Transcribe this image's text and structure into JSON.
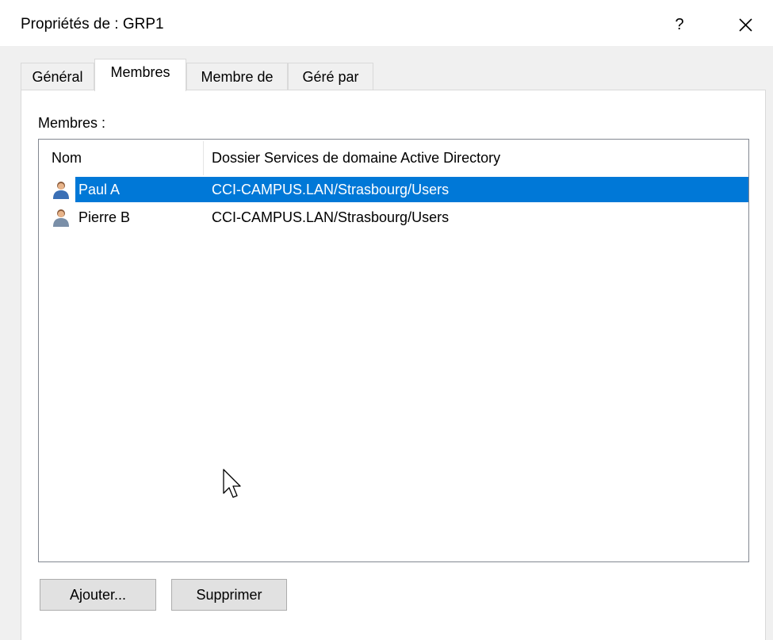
{
  "window": {
    "title": "Propriétés de : GRP1",
    "help_label": "?"
  },
  "tabs": [
    {
      "label": "Général",
      "active": false
    },
    {
      "label": "Membres",
      "active": true
    },
    {
      "label": "Membre de",
      "active": false
    },
    {
      "label": "Géré par",
      "active": false
    }
  ],
  "members": {
    "label": "Membres :",
    "columns": [
      "Nom",
      "Dossier Services de domaine Active Directory"
    ],
    "rows": [
      {
        "name": "Paul A",
        "folder": "CCI-CAMPUS.LAN/Strasbourg/Users",
        "selected": true
      },
      {
        "name": "Pierre B",
        "folder": "CCI-CAMPUS.LAN/Strasbourg/Users",
        "selected": false
      }
    ]
  },
  "buttons": {
    "add_label": "Ajouter...",
    "remove_label": "Supprimer"
  },
  "colors": {
    "selection": "#0078d7",
    "dialog_bg": "#f0f0f0",
    "button_bg": "#e1e1e1"
  },
  "icons": {
    "help": "help-icon",
    "close": "close-icon",
    "user": "user-icon",
    "cursor": "mouse-pointer-icon"
  }
}
